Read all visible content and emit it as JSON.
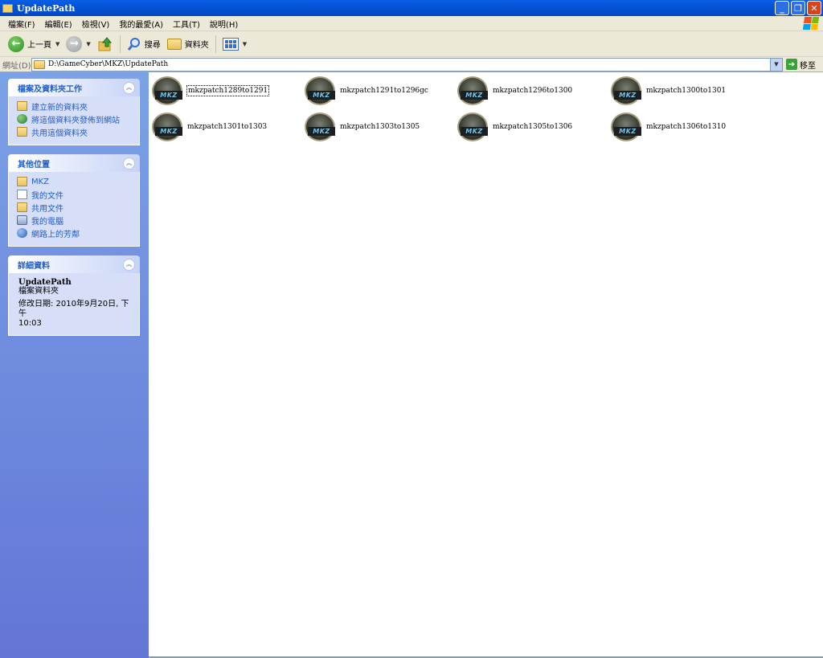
{
  "window": {
    "title": "UpdatePath",
    "buttons": [
      "minimize",
      "maximize",
      "close"
    ]
  },
  "menubar": {
    "items": [
      "檔案(F)",
      "編輯(E)",
      "檢視(V)",
      "我的最愛(A)",
      "工具(T)",
      "說明(H)"
    ]
  },
  "toolbar": {
    "back_label": "上一頁",
    "search_label": "搜尋",
    "folders_label": "資料夾"
  },
  "address": {
    "label": "網址(D)",
    "path": "D:\\GameCyber\\MKZ\\UpdatePath",
    "go_label": "移至"
  },
  "left_pane": {
    "file_tasks": {
      "title": "檔案及資料夾工作",
      "items": [
        "建立新的資料夾",
        "將這個資料夾發佈到網站",
        "共用這個資料夾"
      ]
    },
    "other_places": {
      "title": "其他位置",
      "items": [
        "MKZ",
        "我的文件",
        "共用文件",
        "我的電腦",
        "網路上的芳鄰"
      ]
    },
    "details": {
      "title": "詳細資料",
      "name": "UpdatePath",
      "type": "檔案資料夾",
      "modified_line1": "修改日期: 2010年9月20日, 下午",
      "modified_line2": "10:03"
    }
  },
  "files": [
    "mkzpatch1289to1291",
    "mkzpatch1291to1296gc",
    "mkzpatch1296to1300",
    "mkzpatch1300to1301",
    "mkzpatch1301to1303",
    "mkzpatch1303to1305",
    "mkzpatch1305to1306",
    "mkzpatch1306to1310"
  ],
  "colors": {
    "titlebar": "#0453d6",
    "left_pane_top": "#7ba2e7",
    "left_pane_bottom": "#6375d6",
    "task_link": "#215dc6"
  }
}
